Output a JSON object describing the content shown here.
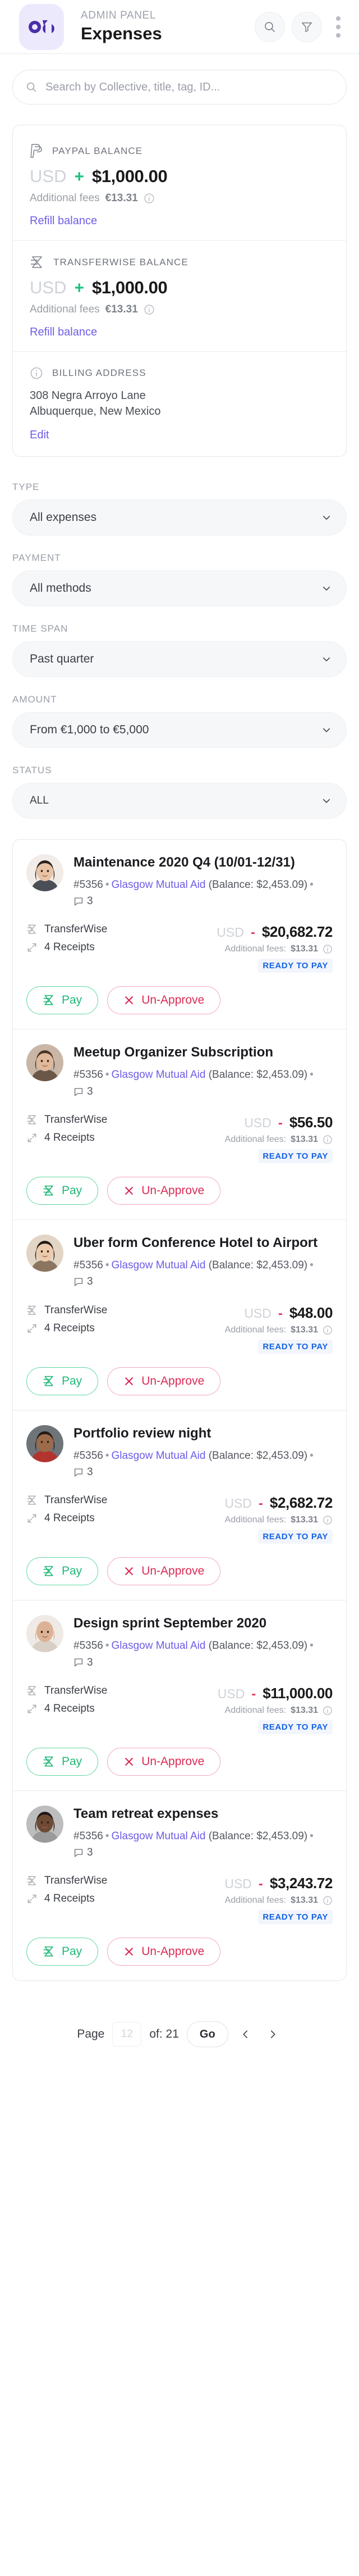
{
  "header": {
    "kicker": "ADMIN PANEL",
    "title": "Expenses",
    "logo_icon": "opencollective-logo-icon",
    "search_icon": "search-icon",
    "filter_icon": "filter-funnel-icon",
    "kebab_icon": "more-vertical-icon"
  },
  "search": {
    "placeholder": "Search by Collective, title, tag, ID...",
    "value": "",
    "icon": "search-icon"
  },
  "balances": [
    {
      "icon": "paypal-icon",
      "label": "PAYPAL BALANCE",
      "currency": "USD",
      "sign": "+",
      "amount": "$1,000.00",
      "fees_label": "Additional fees",
      "fees_amount": "€13.31",
      "info_icon": "info-circle-icon",
      "action": "Refill balance"
    },
    {
      "icon": "transferwise-icon",
      "label": "TRANSFERWISE BALANCE",
      "currency": "USD",
      "sign": "+",
      "amount": "$1,000.00",
      "fees_label": "Additional fees",
      "fees_amount": "€13.31",
      "info_icon": "info-circle-icon",
      "action": "Refill balance"
    }
  ],
  "billing": {
    "icon": "info-circle-icon",
    "label": "BILLING ADDRESS",
    "line1": "308 Negra Arroyo Lane",
    "line2": "Albuquerque, New Mexico",
    "action": "Edit"
  },
  "filters": [
    {
      "label": "TYPE",
      "value": "All expenses",
      "chevron": "chevron-down-icon"
    },
    {
      "label": "PAYMENT",
      "value": "All methods",
      "chevron": "chevron-down-icon"
    },
    {
      "label": "TIME SPAN",
      "value": "Past quarter",
      "chevron": "chevron-down-icon"
    },
    {
      "label": "AMOUNT",
      "value": "From €1,000 to €5,000",
      "chevron": "chevron-down-icon"
    },
    {
      "label": "STATUS",
      "value": "ALL",
      "chevron": "chevron-down-icon"
    }
  ],
  "expense_labels": {
    "balance_prefix": "(Balance:",
    "balance_suffix": ")",
    "fees_label": "Additional fees:",
    "info_icon": "info-circle-icon",
    "comment_icon": "comment-icon",
    "receipt_icon": "expand-arrows-icon",
    "payment_icon": "transferwise-icon",
    "pay_label": "Pay",
    "pay_icon": "transferwise-icon",
    "unapprove_label": "Un-Approve",
    "unapprove_icon": "close-x-icon"
  },
  "expenses": [
    {
      "title": "Maintenance 2020 Q4 (10/01-12/31)",
      "id": "#5356",
      "collective": "Glasgow Mutual Aid",
      "collective_balance": "$2,453.09",
      "comments": "3",
      "payment_method": "TransferWise",
      "receipts": "4 Receipts",
      "currency": "USD",
      "sign": "-",
      "amount": "$20,682.72",
      "fees": "$13.31",
      "status": "READY TO PAY",
      "avatar": "avatar-woman-dark-hair"
    },
    {
      "title": "Meetup Organizer Subscription",
      "id": "#5356",
      "collective": "Glasgow Mutual Aid",
      "collective_balance": "$2,453.09",
      "comments": "3",
      "payment_method": "TransferWise",
      "receipts": "4 Receipts",
      "currency": "USD",
      "sign": "-",
      "amount": "$56.50",
      "fees": "$13.31",
      "status": "READY TO PAY",
      "avatar": "avatar-woman-profile"
    },
    {
      "title": "Uber form Conference Hotel to Airport",
      "id": "#5356",
      "collective": "Glasgow Mutual Aid",
      "collective_balance": "$2,453.09",
      "comments": "3",
      "payment_method": "TransferWise",
      "receipts": "4 Receipts",
      "currency": "USD",
      "sign": "-",
      "amount": "$48.00",
      "fees": "$13.31",
      "status": "READY TO PAY",
      "avatar": "avatar-woman-short-hair"
    },
    {
      "title": "Portfolio review night",
      "id": "#5356",
      "collective": "Glasgow Mutual Aid",
      "collective_balance": "$2,453.09",
      "comments": "3",
      "payment_method": "TransferWise",
      "receipts": "4 Receipts",
      "currency": "USD",
      "sign": "-",
      "amount": "$2,682.72",
      "fees": "$13.31",
      "status": "READY TO PAY",
      "avatar": "avatar-man-curly-hair"
    },
    {
      "title": "Design sprint September 2020",
      "id": "#5356",
      "collective": "Glasgow Mutual Aid",
      "collective_balance": "$2,453.09",
      "comments": "3",
      "payment_method": "TransferWise",
      "receipts": "4 Receipts",
      "currency": "USD",
      "sign": "-",
      "amount": "$11,000.00",
      "fees": "$13.31",
      "status": "READY TO PAY",
      "avatar": "avatar-man-bald"
    },
    {
      "title": "Team retreat expenses",
      "id": "#5356",
      "collective": "Glasgow Mutual Aid",
      "collective_balance": "$2,453.09",
      "comments": "3",
      "payment_method": "TransferWise",
      "receipts": "4 Receipts",
      "currency": "USD",
      "sign": "-",
      "amount": "$3,243.72",
      "fees": "$13.31",
      "status": "READY TO PAY",
      "avatar": "avatar-woman-headband"
    }
  ],
  "pagination": {
    "page_label": "Page",
    "page_placeholder": "12",
    "page_value": "",
    "of_label": "of: 21",
    "go_label": "Go",
    "prev_icon": "chevron-left-icon",
    "next_icon": "chevron-right-icon"
  },
  "colors": {
    "accent": "#6c5ce8",
    "positive": "#1bc47d",
    "negative": "#e8375f",
    "status": "#1463e6",
    "pay_border": "#5fd8a0",
    "unapprove_border": "#f4a6bb"
  }
}
